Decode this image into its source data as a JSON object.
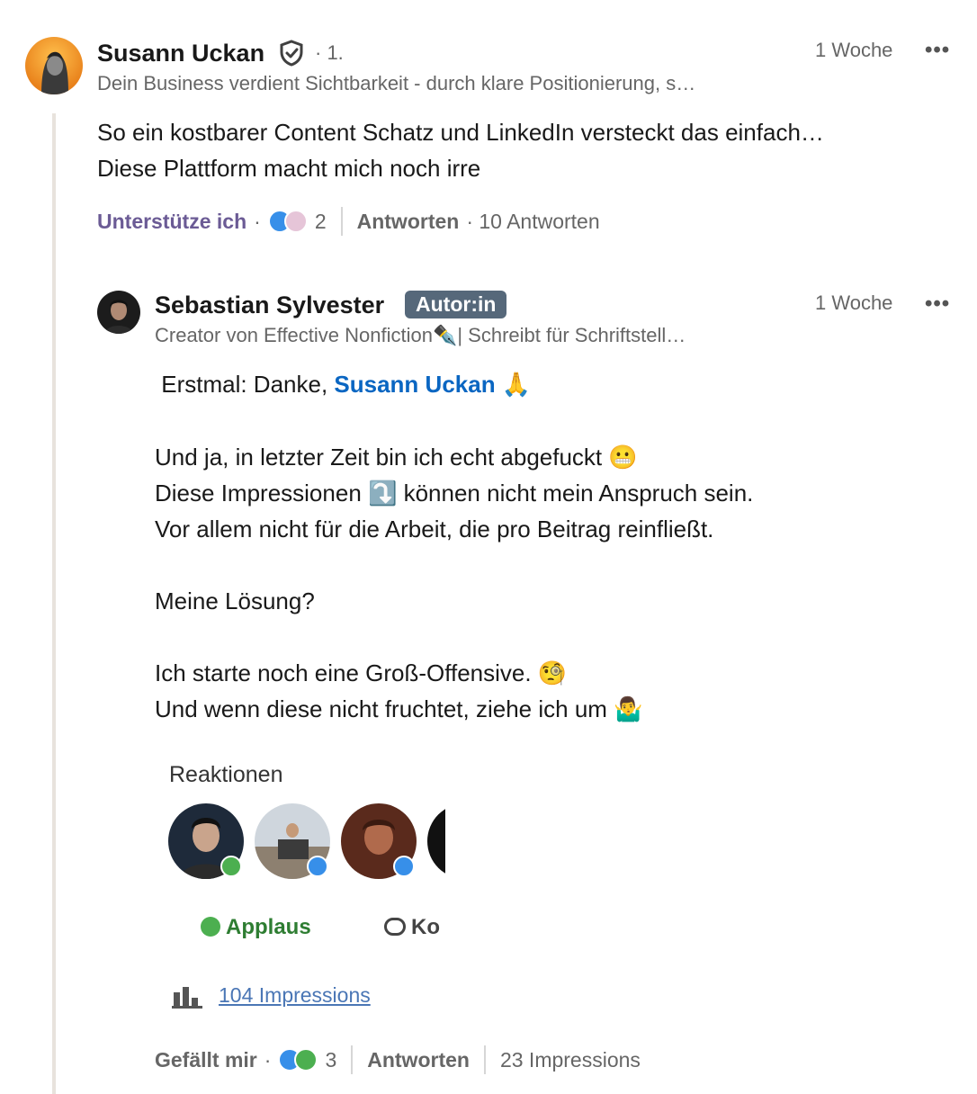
{
  "comment": {
    "author_name": "Susann Uckan",
    "degree": "· 1.",
    "headline": "Dein Business verdient Sichtbarkeit - durch klare Positionierung, s…",
    "time": "1 Woche",
    "more": "•••",
    "text_lines": [
      "So ein kostbarer Content Schatz und LinkedIn versteckt das einfach…",
      "Diese Plattform macht mich noch irre"
    ],
    "reaction_label": "Unterstütze ich",
    "dot": "·",
    "reaction_count": "2",
    "reply_label": "Antworten",
    "replies_count_text": "· 10 Antworten",
    "colors": {
      "support_purple": "#6b5b95",
      "thread_line": "#e8e3dd"
    }
  },
  "reply": {
    "author_name": "Sebastian Sylvester",
    "badge": "Autor:in",
    "headline": "Creator von Effective Nonfiction✒️| Schreibt für Schriftstell…",
    "time": "1 Woche",
    "more": "•••",
    "greeting_prefix": " Erstmal: Danke, ",
    "mention": "Susann Uckan",
    "greeting_emoji": "🙏",
    "line1": "Und ja, in letzter Zeit bin ich echt abgefuckt 😬",
    "line2": "Diese Impressionen ⤵️ können nicht mein Anspruch sein.",
    "line3": "Vor allem nicht für die Arbeit, die pro Beitrag reinfließt.",
    "line4": "Meine Lösung?",
    "line5": "Ich starte noch eine Groß-Offensive. 🧐",
    "line6": "Und wenn diese nicht fruchtet, ziehe ich um 🤷‍♂️",
    "embed": {
      "title": "Reaktionen",
      "tab_applause": "Applaus",
      "tab_comments": "Ko",
      "impressions_link": "104 Impressions"
    },
    "like_label": "Gefällt mir",
    "dot": "·",
    "reaction_count": "3",
    "reply_label": "Antworten",
    "impressions_text": "23 Impressions",
    "colors": {
      "mention_blue": "#0a66c2",
      "badge_bg": "#56687a",
      "applause_green": "#2e7d32"
    }
  }
}
